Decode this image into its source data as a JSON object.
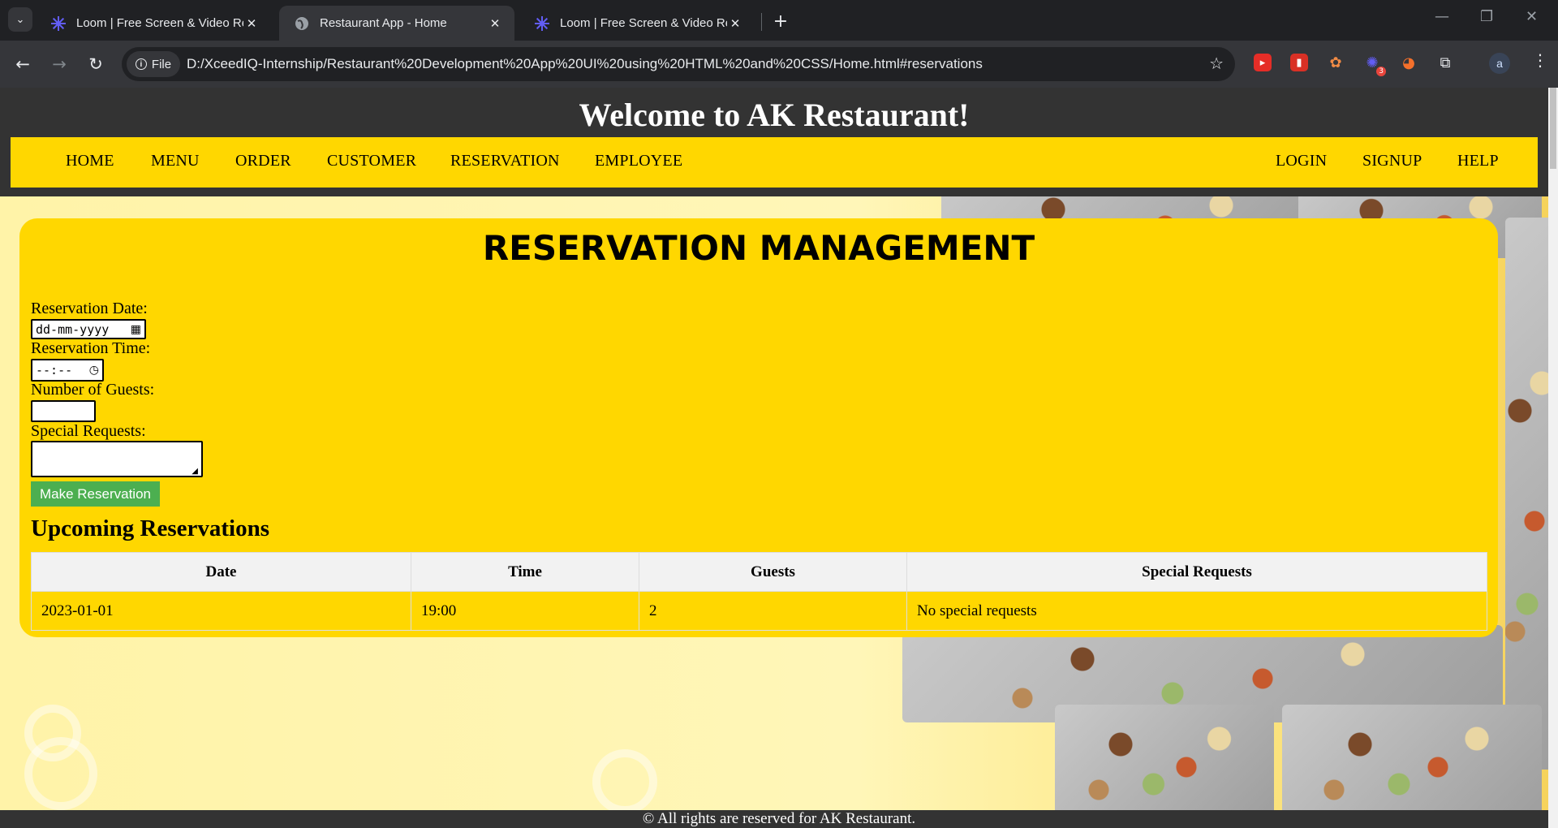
{
  "browser": {
    "tabs": [
      {
        "title": "Loom | Free Screen & Video Recording",
        "active": false,
        "icon": "loom-icon"
      },
      {
        "title": "Restaurant App - Home",
        "active": true,
        "icon": "globe-icon"
      },
      {
        "title": "Loom | Free Screen & Video Recording",
        "active": false,
        "icon": "loom-icon"
      }
    ],
    "chip_label": "File",
    "url": "D:/XceedIQ-Internship/Restaurant%20Development%20App%20UI%20using%20HTML%20and%20CSS/Home.html#reservations",
    "avatar_letter": "a",
    "extension_badge": "3"
  },
  "site": {
    "title": "Welcome to AK Restaurant!",
    "nav_left": [
      "HOME",
      "MENU",
      "ORDER",
      "CUSTOMER",
      "RESERVATION",
      "EMPLOYEE"
    ],
    "nav_right": [
      "LOGIN",
      "SIGNUP",
      "HELP"
    ]
  },
  "reservation": {
    "heading": "RESERVATION MANAGEMENT",
    "date_label": "Reservation Date:",
    "date_placeholder": "dd-mm-yyyy",
    "time_label": "Reservation Time:",
    "time_placeholder": "--:--",
    "guests_label": "Number of Guests:",
    "requests_label": "Special Requests:",
    "submit_label": "Make Reservation",
    "upcoming_heading": "Upcoming Reservations",
    "table": {
      "headers": [
        "Date",
        "Time",
        "Guests",
        "Special Requests"
      ],
      "rows": [
        [
          "2023-01-01",
          "19:00",
          "2",
          "No special requests"
        ]
      ]
    }
  },
  "footer": "© All rights are reserved for AK Restaurant.",
  "colors": {
    "nav_bg": "#ffd700",
    "header_bg": "#333333",
    "button": "#4caf50"
  }
}
